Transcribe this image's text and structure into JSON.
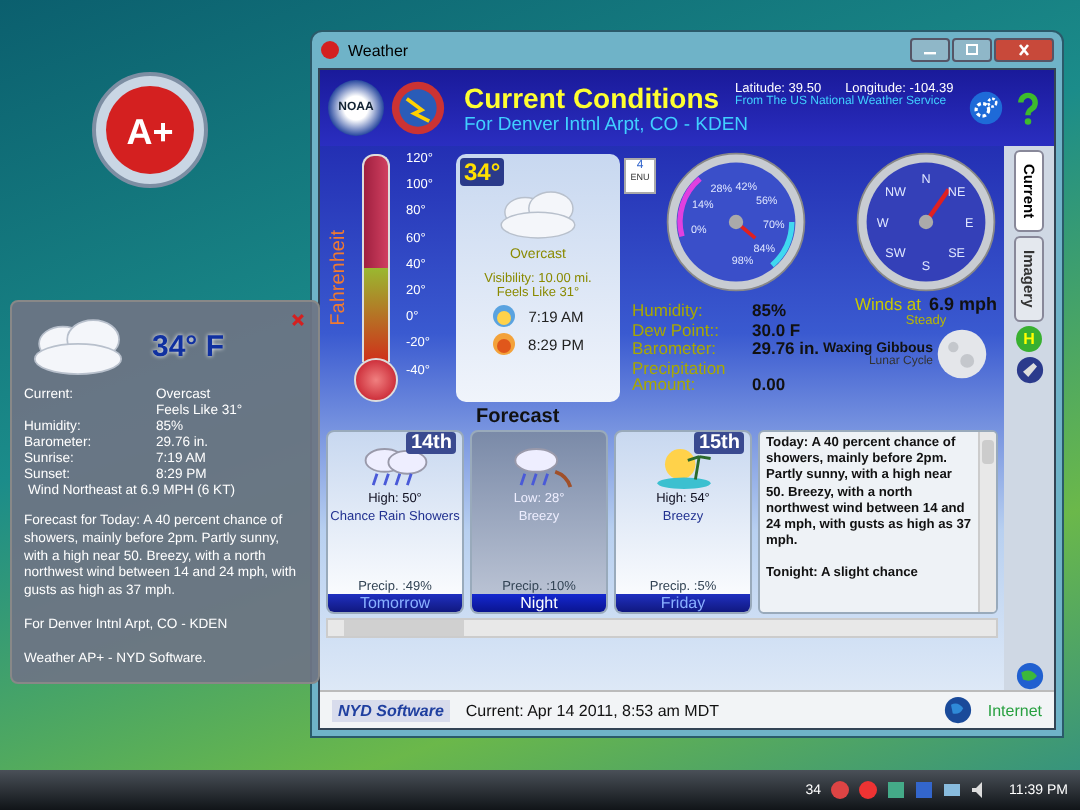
{
  "gadget_icon": {
    "label": "A+"
  },
  "desktop_gadget": {
    "temperature": "34° F",
    "rows": [
      {
        "label": "Current:",
        "value": "Overcast"
      },
      {
        "value": "Feels Like 31°"
      },
      {
        "label": "Humidity:",
        "value": "85%"
      },
      {
        "label": "Barometer:",
        "value": "29.76 in."
      },
      {
        "label": "Sunrise:",
        "value": "7:19 AM"
      },
      {
        "label": "Sunset:",
        "value": "8:29 PM"
      }
    ],
    "wind": "Wind Northeast at 6.9 MPH (6 KT)",
    "forecast": "Forecast for Today: A 40 percent chance of showers, mainly before 2pm.  Partly sunny, with a high near 50. Breezy, with a north northwest wind between 14 and 24 mph, with gusts as high as 37 mph.",
    "location": "For Denver Intnl Arpt, CO - KDEN",
    "credit": "Weather AP+ - NYD Software."
  },
  "window": {
    "title": "Weather"
  },
  "header": {
    "title": "Current Conditions",
    "location": "For Denver Intnl Arpt, CO - KDEN",
    "latitude": "Latitude: 39.50",
    "longitude": "Longitude: -104.39",
    "source": "From The US National Weather Service",
    "logo_badge": "NOAA"
  },
  "thermometer": {
    "label": "Fahrenheit",
    "ticks": [
      "120°",
      "100°",
      "80°",
      "60°",
      "40°",
      "20°",
      "0°",
      "-20°",
      "-40°"
    ],
    "level": 0.46
  },
  "current": {
    "temperature": "34°",
    "condition": "Overcast",
    "visibility": "Visibility: 10.00 mi.",
    "feels_like": "Feels Like 31°",
    "sunrise": "7:19 AM",
    "sunset": "8:29 PM"
  },
  "enu_badge": {
    "value": "4",
    "label": "ENU"
  },
  "humidity_gauge": {
    "labels": [
      "0%",
      "14%",
      "28%",
      "42%",
      "56%",
      "70%",
      "84%",
      "98%"
    ]
  },
  "compass": {
    "labels": [
      "N",
      "NE",
      "E",
      "SE",
      "S",
      "SW",
      "W",
      "NW"
    ]
  },
  "stats": [
    {
      "label": "Humidity:",
      "value": "85%"
    },
    {
      "label": "Dew Point::",
      "value": "30.0 F"
    },
    {
      "label": "Barometer:",
      "value": "29.76 in."
    },
    {
      "label": "Precipitation Amount:",
      "value": "0.00"
    }
  ],
  "wind": {
    "label": "Winds at",
    "value": "6.9 mph",
    "trend": "Steady"
  },
  "moon": {
    "phase": "Waxing Gibbous",
    "caption": "Lunar Cycle"
  },
  "forecast": {
    "title": "Forecast",
    "days": [
      {
        "kind": "rain",
        "date": "14th",
        "temp": "High: 50°",
        "summary": "Chance Rain Showers",
        "precip": "Precip. :49%",
        "name": "Tomorrow",
        "selected": false
      },
      {
        "kind": "night",
        "temp": "Low: 28°",
        "summary": "Breezy",
        "precip": "Precip. :10%",
        "name": "Night",
        "selected": true
      },
      {
        "kind": "sun",
        "date": "15th",
        "temp": "High: 54°",
        "summary": "Breezy",
        "precip": "Precip. :5%",
        "name": "Friday",
        "selected": false
      }
    ],
    "text": [
      "Today: A 40 percent chance of showers, mainly before 2pm.  Partly sunny, with a high near 50. Breezy, with a north northwest wind between 14 and 24 mph, with gusts as high as 37 mph.",
      "Tonight: A slight chance"
    ]
  },
  "tabs": [
    {
      "label": "Current",
      "selected": true
    },
    {
      "label": "Imagery",
      "selected": false
    }
  ],
  "side_badge": "H",
  "status_bar": {
    "logo": "NYD Software",
    "timestamp": "Current:  Apr 14 2011, 8:53 am MDT",
    "zone": "Internet"
  },
  "taskbar": {
    "temperature": "34",
    "clock": "11:39 PM"
  }
}
